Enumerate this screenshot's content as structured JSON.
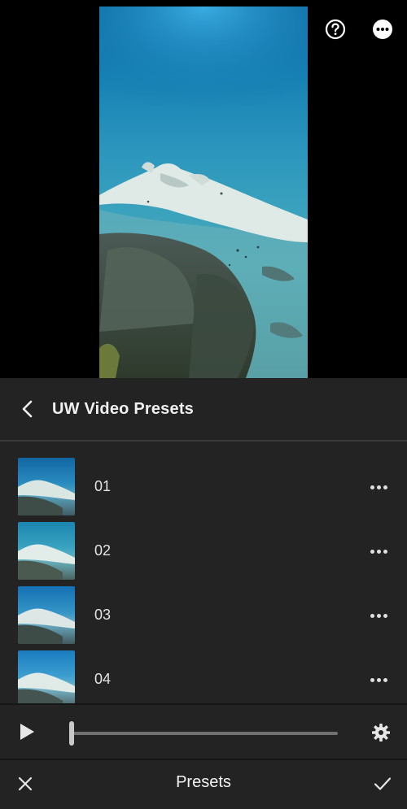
{
  "panel": {
    "title": "UW Video Presets"
  },
  "presets": [
    {
      "name": "01"
    },
    {
      "name": "02"
    },
    {
      "name": "03"
    },
    {
      "name": "04"
    }
  ],
  "playback": {
    "position": 0.0
  },
  "bottom_bar": {
    "title": "Presets"
  },
  "icons": {
    "help": "help-circle-icon",
    "more": "more-horizontal-icon",
    "back": "chevron-left-icon",
    "play": "play-icon",
    "settings": "gear-icon",
    "close": "close-icon",
    "confirm": "checkmark-icon"
  },
  "colors": {
    "panel_bg": "#232323",
    "header_divider": "#3a3a3a",
    "text": "#eaeaea",
    "track": "#707070",
    "handle": "#c8c8c8"
  }
}
